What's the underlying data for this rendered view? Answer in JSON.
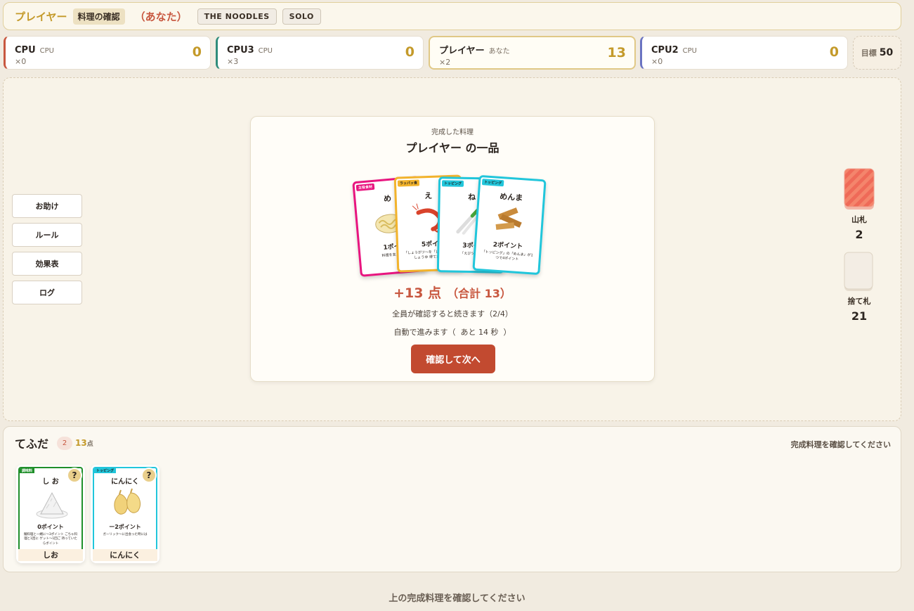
{
  "topbar": {
    "title": "プレイヤー",
    "phase": "料理の確認",
    "you": "（あなた）",
    "tags": [
      "THE NOODLES",
      "SOLO"
    ]
  },
  "seats": [
    {
      "name": "CPU",
      "role": "CPU",
      "count": "×0",
      "score": "0",
      "color": "#c8573f"
    },
    {
      "name": "CPU3",
      "role": "CPU",
      "count": "×3",
      "score": "0",
      "color": "#2f8d7c"
    },
    {
      "name": "プレイヤー",
      "role": "あなた",
      "count": "×2",
      "score": "13",
      "color": "#c49a2a"
    },
    {
      "name": "CPU2",
      "role": "CPU",
      "count": "×0",
      "score": "0",
      "color": "#6a73c2"
    }
  ],
  "goal": {
    "label": "目標",
    "value": "50"
  },
  "side_buttons": [
    "お助け",
    "ルール",
    "効果表",
    "ログ"
  ],
  "dish": {
    "label": "完成した料理",
    "title": "プレイヤー の一品",
    "score": "+13 点",
    "total": "（合計 13）",
    "wait": "全員が確認すると続きます（2/4）",
    "auto_prefix": "自動で進みます（",
    "auto_countdown": "あと 14 秒",
    "auto_suffix": "）",
    "confirm_button": "確認して次へ",
    "cards": [
      {
        "name": "め",
        "category": "主役食材",
        "points": "1ポイ",
        "desc": "料理を支える",
        "color": "#e8157f"
      },
      {
        "name": "え",
        "category": "ラッパッ食",
        "points": "5ポイ",
        "desc": "「しょうがツ～を「しょうがっ」しょうゆ  得てた場合",
        "color": "#f2b32c"
      },
      {
        "name": "ね",
        "category": "トッピング",
        "points": "3ポイ",
        "desc": "「えびツ～持",
        "color": "#21c6db"
      },
      {
        "name": "めんま",
        "category": "トッピング",
        "points": "2ポイント",
        "desc": "「トッピング」の「めんま」が1つで4ポイント",
        "color": "#21c6db"
      }
    ]
  },
  "piles": {
    "deck": {
      "label": "山札",
      "count": "2"
    },
    "discard": {
      "label": "捨て札",
      "count": "21"
    }
  },
  "hand": {
    "title": "てふだ",
    "count": "2",
    "points": "13",
    "points_unit": "点",
    "message": "完成料理を確認してください",
    "cards": [
      {
        "name": "し お",
        "label": "しお",
        "category": "調味料",
        "points": "0ポイント",
        "desc": "麺料理と一緒に～3ポイント  ごちゃ料理と1回に ゲット～1回ご 持っていたらボイント",
        "color": "#1f8f2a"
      },
      {
        "name": "にんにく",
        "label": "にんにく",
        "category": "トッピング",
        "points": "ー2ポイント",
        "desc": "ガーリック～に出会った時には",
        "color": "#21c6db"
      }
    ]
  },
  "footer": "上の完成料理を確認してください"
}
